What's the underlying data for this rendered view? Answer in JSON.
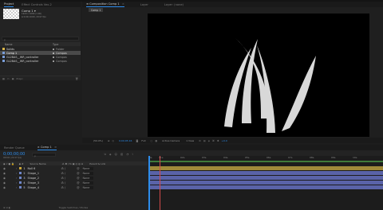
{
  "project_panel": {
    "tabs": [
      {
        "label": "Project",
        "active": true
      },
      {
        "label": "Effect Controls Vex-2",
        "active": false
      }
    ],
    "comp_name": "Comp 1 ▾",
    "comp_info": [
      "1920 x 1080 (1.00)",
      "Δ 0;00;10;00, 29.97 fps"
    ],
    "search_placeholder": "ρ",
    "columns": {
      "name": "Name",
      "type": "Type"
    },
    "items": [
      {
        "name": "Solids",
        "type": "Folder",
        "color": "#d9b54a"
      },
      {
        "name": "Comp 1",
        "type": "Compos",
        "color": "#7a9ed8"
      },
      {
        "name": "GL2BAS__WR_controller",
        "type": "Compos",
        "color": "#7a9ed8"
      },
      {
        "name": "GL2BAS__WR_controller",
        "type": "Compos",
        "color": "#7a9ed8"
      }
    ],
    "bpc_label": "8 bpc"
  },
  "viewer": {
    "tabs": [
      {
        "label": "Composition Comp 1",
        "active": true
      },
      {
        "label": "Layer",
        "active": false
      },
      {
        "label": "Layer: (none)",
        "active": false
      }
    ],
    "breadcrumb": "Comp 1",
    "footer": {
      "zoom": "(50.0%)",
      "timecode": "0;00;05;16",
      "resolution": "Full",
      "camera": "Active Camera",
      "views": "1 View",
      "offset": "+0.0"
    }
  },
  "timeline": {
    "tabs": [
      {
        "label": "Render Queue",
        "active": false
      },
      {
        "label": "Comp 1",
        "active": true
      }
    ],
    "timecode": "0;00;00;00",
    "fps_info": "00000 (29.97 fps)",
    "columns": {
      "source_name": "Source Name",
      "parent": "Parent & Link"
    },
    "layers": [
      {
        "num": "1",
        "name": "Null 6",
        "color": "#c9a436",
        "parent": "None"
      },
      {
        "num": "2",
        "name": "Shape_1",
        "color": "#6f86c8",
        "parent": "None"
      },
      {
        "num": "3",
        "name": "Shape_2",
        "color": "#6f86c8",
        "parent": "None"
      },
      {
        "num": "4",
        "name": "Shape_3",
        "color": "#6f86c8",
        "parent": "None"
      },
      {
        "num": "5",
        "name": "Shape_4",
        "color": "#6f86c8",
        "parent": "None"
      }
    ],
    "ruler_ticks": [
      "0s",
      "01s",
      "02s",
      "03s",
      "04s",
      "05s",
      "06s",
      "07s",
      "08s",
      "09s",
      "10s"
    ],
    "mode_label": "Toggle Switches / Modes"
  },
  "colors": {
    "accent": "#2d8ceb",
    "playhead": "#d24a4a",
    "null_bar": "#a08a3a",
    "shape_bar": "#5a63a8",
    "work_area": "#3f7a3a",
    "shape_fill": "#d8d8d8"
  }
}
